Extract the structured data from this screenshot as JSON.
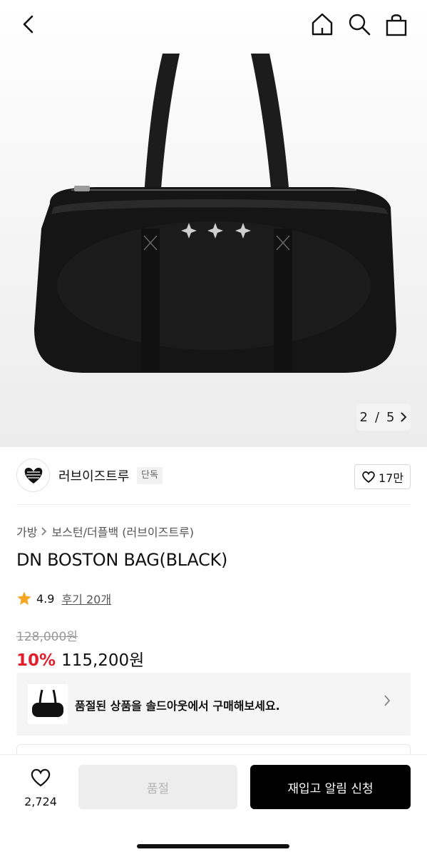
{
  "hero": {
    "pager": {
      "current": "2",
      "separator": "/",
      "total": "5"
    }
  },
  "icons": {
    "back": "back-arrow-icon",
    "home": "home-icon",
    "search": "search-icon",
    "cart": "shopping-bag-icon",
    "like": "heart-icon",
    "rating": "star-icon"
  },
  "brand": {
    "name": "러브이즈트루",
    "badge": "단독",
    "likes": "17만"
  },
  "breadcrumb": [
    "가방",
    "보스턴/더플백 (러브이즈트루)"
  ],
  "product": {
    "title": "DN BOSTON BAG(BLACK)",
    "rating": "4.9",
    "reviews": "후기 20개",
    "original_price": "128,000원",
    "discount": "10%",
    "sale_price": "115,200원"
  },
  "banner": {
    "text": "품절된 상품을 솔드아웃에서 구매해보세요."
  },
  "bottom": {
    "wish_count": "2,724",
    "soldout_label": "품절",
    "restock_label": "재입고 알림 신청"
  },
  "colors": {
    "discount": "#e0202d",
    "star": "#f5a623",
    "primary_button": "#000000"
  }
}
